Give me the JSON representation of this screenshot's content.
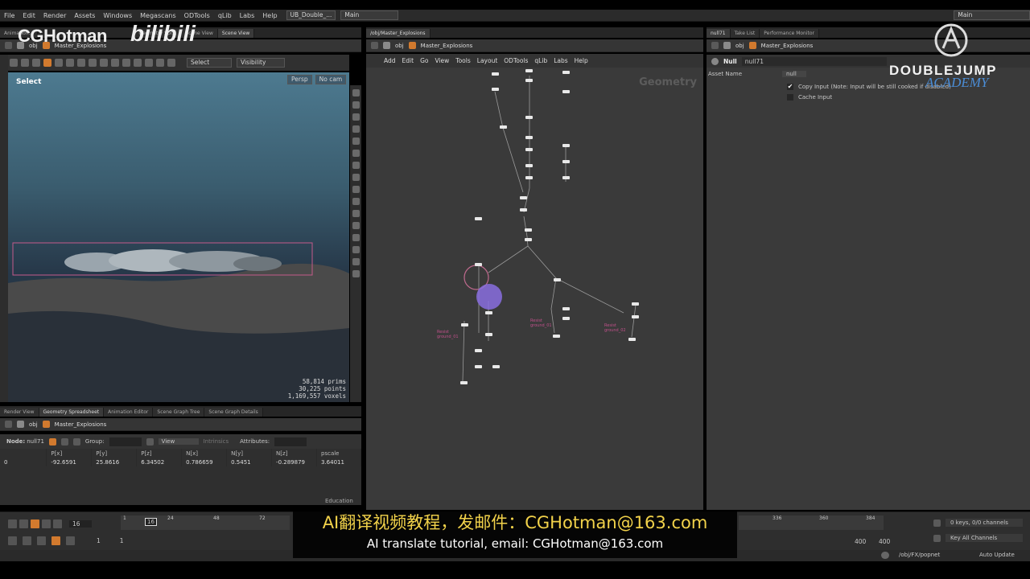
{
  "menubar": {
    "items": [
      "File",
      "Edit",
      "Render",
      "Assets",
      "Windows",
      "Megascans",
      "ODTools",
      "qLib",
      "Labs",
      "Help"
    ],
    "desktop_file": "UB_Double_...",
    "desktop": "Main",
    "right_desktop": "Main"
  },
  "left_tabs": [
    "Animation...",
    "Geometry Spr...",
    "Scene View",
    "Scene View"
  ],
  "left_path": {
    "context": "obj",
    "network": "Master_Explosions"
  },
  "viewport": {
    "mode": "Select",
    "select_dropdown": "Select",
    "visibility_dropdown": "Visibility",
    "camera_persp": "Persp",
    "camera_name": "No cam",
    "stats": [
      {
        "value": "58,814",
        "label": "prims"
      },
      {
        "value": "30,225",
        "label": "points"
      },
      {
        "value": "1,169,557",
        "label": "voxels"
      }
    ]
  },
  "network": {
    "tab_path": "/obj/Master_Explosions",
    "path": {
      "context": "obj",
      "network": "Master_Explosions"
    },
    "menu": [
      "Add",
      "Edit",
      "Go",
      "View",
      "Tools",
      "Layout",
      "ODTools",
      "qLib",
      "Labs",
      "Help"
    ],
    "context_label": "Geometry",
    "sticky_notes": [
      "Resist ground_01",
      "Resist ground_01",
      "Resist ground_02"
    ]
  },
  "params": {
    "tabs": [
      "null71",
      "Take List",
      "Performance Monitor"
    ],
    "path": {
      "context": "obj",
      "network": "Master_Explosions"
    },
    "node_type": "Null",
    "node_name": "null71",
    "asset_name_label": "Asset Name",
    "asset_name_value": "null",
    "copy_input_label": "Copy Input (Note: Input will be still cooked if disabled)",
    "copy_input_checked": true,
    "cache_input_label": "Cache Input"
  },
  "sheet": {
    "tabs": [
      "Render View",
      "Geometry Spreadsheet",
      "Animation Editor",
      "Scene Graph Tree",
      "Scene Graph Details"
    ],
    "path": {
      "context": "obj",
      "network": "Master_Explosions"
    },
    "node_label": "Node:",
    "node_name": "null71",
    "group_label": "Group:",
    "view_label": "View",
    "intrinsics_label": "Intrinsics",
    "attributes_label": "Attributes:",
    "columns": [
      "",
      "P[x]",
      "P[y]",
      "P[z]",
      "N[x]",
      "N[y]",
      "N[z]",
      "pscale"
    ],
    "rows": [
      [
        "0",
        "-92.6591",
        "25.8616",
        "6.34502",
        "0.786659",
        "0.5451",
        "-0.289879",
        "3.64011"
      ]
    ],
    "license": "Education"
  },
  "timeline": {
    "current_frame": "16",
    "ticks": [
      "1",
      "24",
      "48",
      "72",
      "336",
      "360",
      "384"
    ],
    "start": "1",
    "start2": "1",
    "end": "400",
    "end2": "400",
    "keys_status": "0 keys, 0/0 channels",
    "key_all": "Key All Channels"
  },
  "statusbar": {
    "path": "/obj/FX/popnet",
    "auto_update": "Auto Update"
  },
  "subtitle": {
    "cn": "AI翻译视频教程，发邮件：CGHotman@163.com",
    "en": "AI translate tutorial, email: CGHotman@163.com"
  },
  "watermarks": {
    "cghotman": "CGHotman",
    "bilibili": "bilibili",
    "doublejump": "DOUBLEJUMP",
    "academy": "ACADEMY"
  },
  "colors": {
    "subtitle_cn": "#f2d24a",
    "academy_blue": "#4b8dd6",
    "selected_node": "#8a6fe0",
    "sticky_text": "#c0508a",
    "accent_orange": "#d27a2e"
  }
}
